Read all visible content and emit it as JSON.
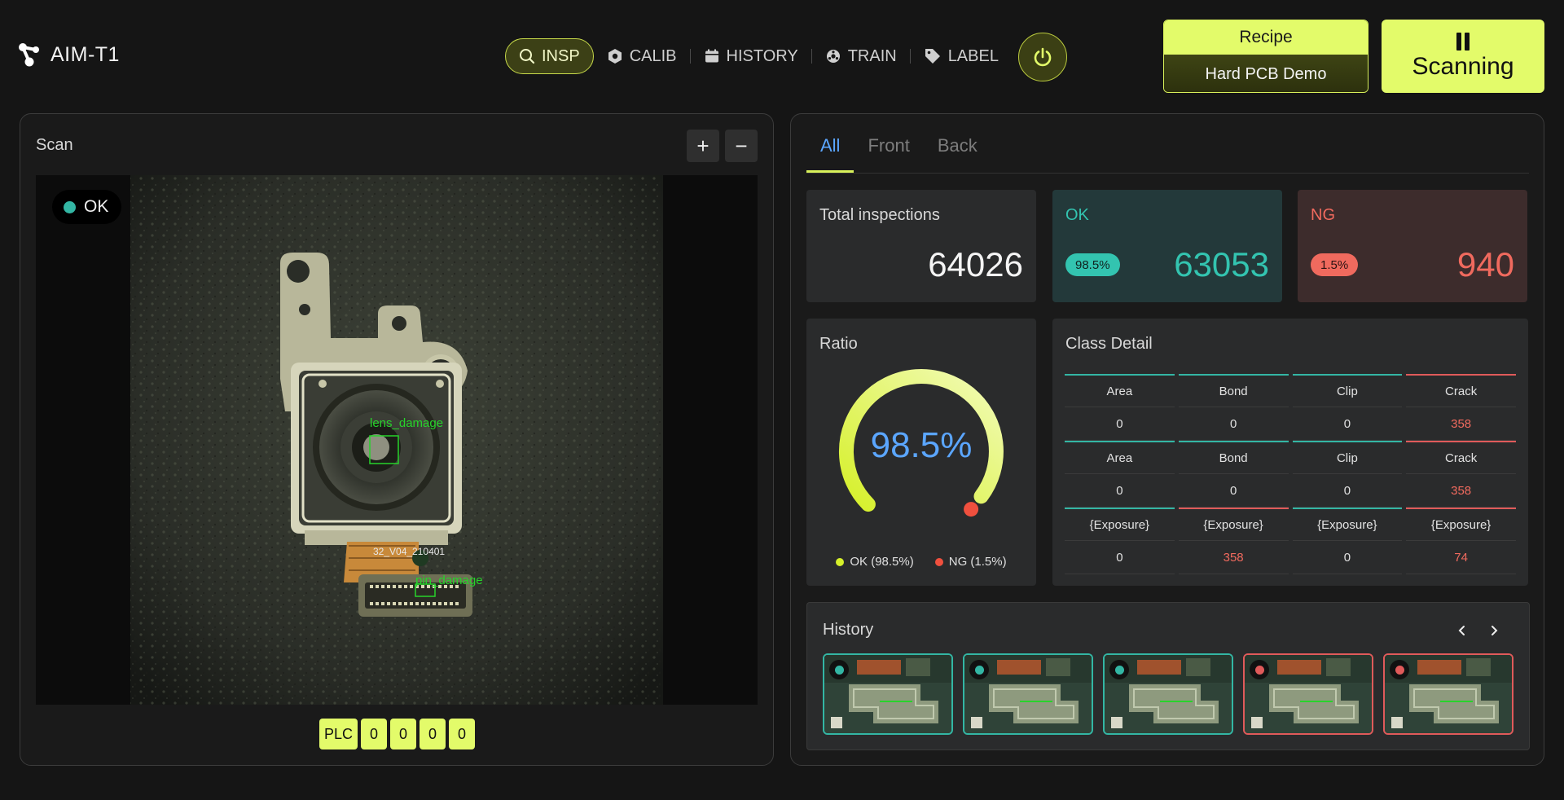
{
  "app": {
    "title": "AIM-T1"
  },
  "nav": {
    "items": [
      {
        "label": "INSP",
        "icon": "search-icon",
        "active": true
      },
      {
        "label": "CALIB",
        "icon": "hexagon-icon"
      },
      {
        "label": "HISTORY",
        "icon": "calendar-icon"
      },
      {
        "label": "TRAIN",
        "icon": "gear-wheel-icon"
      },
      {
        "label": "LABEL",
        "icon": "tag-icon"
      }
    ]
  },
  "recipe": {
    "label": "Recipe",
    "value": "Hard PCB Demo"
  },
  "scan_button": {
    "label": "Scanning"
  },
  "scan_panel": {
    "title": "Scan",
    "zoom_in": "+",
    "zoom_out": "−",
    "status": "OK",
    "detections": [
      {
        "label": "lens_damage"
      },
      {
        "label": "pin_damage"
      }
    ],
    "part_text": "32_V04_210401",
    "plc": {
      "label": "PLC",
      "values": [
        "0",
        "0",
        "0",
        "0"
      ]
    }
  },
  "tabs": [
    {
      "label": "All",
      "active": true
    },
    {
      "label": "Front"
    },
    {
      "label": "Back"
    }
  ],
  "stats": {
    "total": {
      "label": "Total inspections",
      "value": "64026"
    },
    "ok": {
      "label": "OK",
      "pct": "98.5%",
      "value": "63053"
    },
    "ng": {
      "label": "NG",
      "pct": "1.5%",
      "value": "940"
    }
  },
  "ratio": {
    "title": "Ratio",
    "value_text": "98.5%",
    "ok_fraction": 0.985,
    "legend_ok": "OK (98.5%)",
    "legend_ng": "NG (1.5%)"
  },
  "class_detail": {
    "title": "Class Detail",
    "rows": [
      {
        "headers": [
          "Area",
          "Bond",
          "Clip",
          "Crack"
        ],
        "values": [
          "0",
          "0",
          "0",
          "358"
        ],
        "ng": [
          false,
          false,
          false,
          true
        ]
      },
      {
        "headers": [
          "Area",
          "Bond",
          "Clip",
          "Crack"
        ],
        "values": [
          "0",
          "0",
          "0",
          "358"
        ],
        "ng": [
          false,
          false,
          false,
          true
        ]
      },
      {
        "headers": [
          "{Exposure}",
          "{Exposure}",
          "{Exposure}",
          "{Exposure}"
        ],
        "values": [
          "0",
          "358",
          "0",
          "74"
        ],
        "ng": [
          false,
          true,
          false,
          true
        ]
      }
    ]
  },
  "history": {
    "title": "History",
    "items": [
      {
        "status": "ok"
      },
      {
        "status": "ok"
      },
      {
        "status": "ok"
      },
      {
        "status": "ng"
      },
      {
        "status": "ng"
      }
    ]
  },
  "colors": {
    "accent": "#e3fb6a",
    "ok": "#33b6a4",
    "ng": "#e05a5a",
    "ratio_text": "#5ba6ff"
  }
}
